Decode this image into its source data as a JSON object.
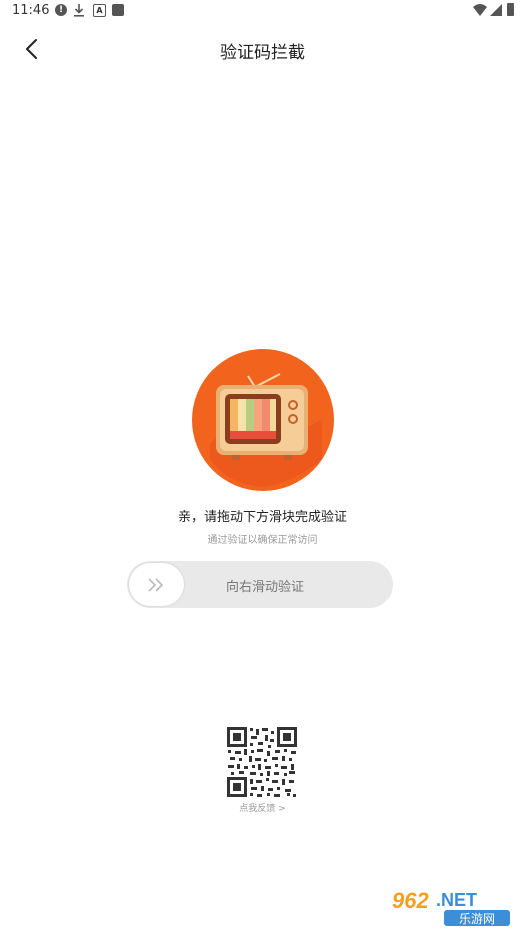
{
  "status_bar": {
    "time": "11:46"
  },
  "header": {
    "title": "验证码拦截"
  },
  "verify": {
    "title": "亲，请拖动下方滑块完成验证",
    "subtitle": "通过验证以确保正常访问",
    "slider_label": "向右滑动验证"
  },
  "feedback": {
    "label": "点我反馈 >"
  },
  "watermark": {
    "brand": "962.NET",
    "sub": "乐游网"
  },
  "colors": {
    "accent": "#F2641E",
    "tv_frame": "#E9B074",
    "slider_bg": "#E9E9E9"
  }
}
